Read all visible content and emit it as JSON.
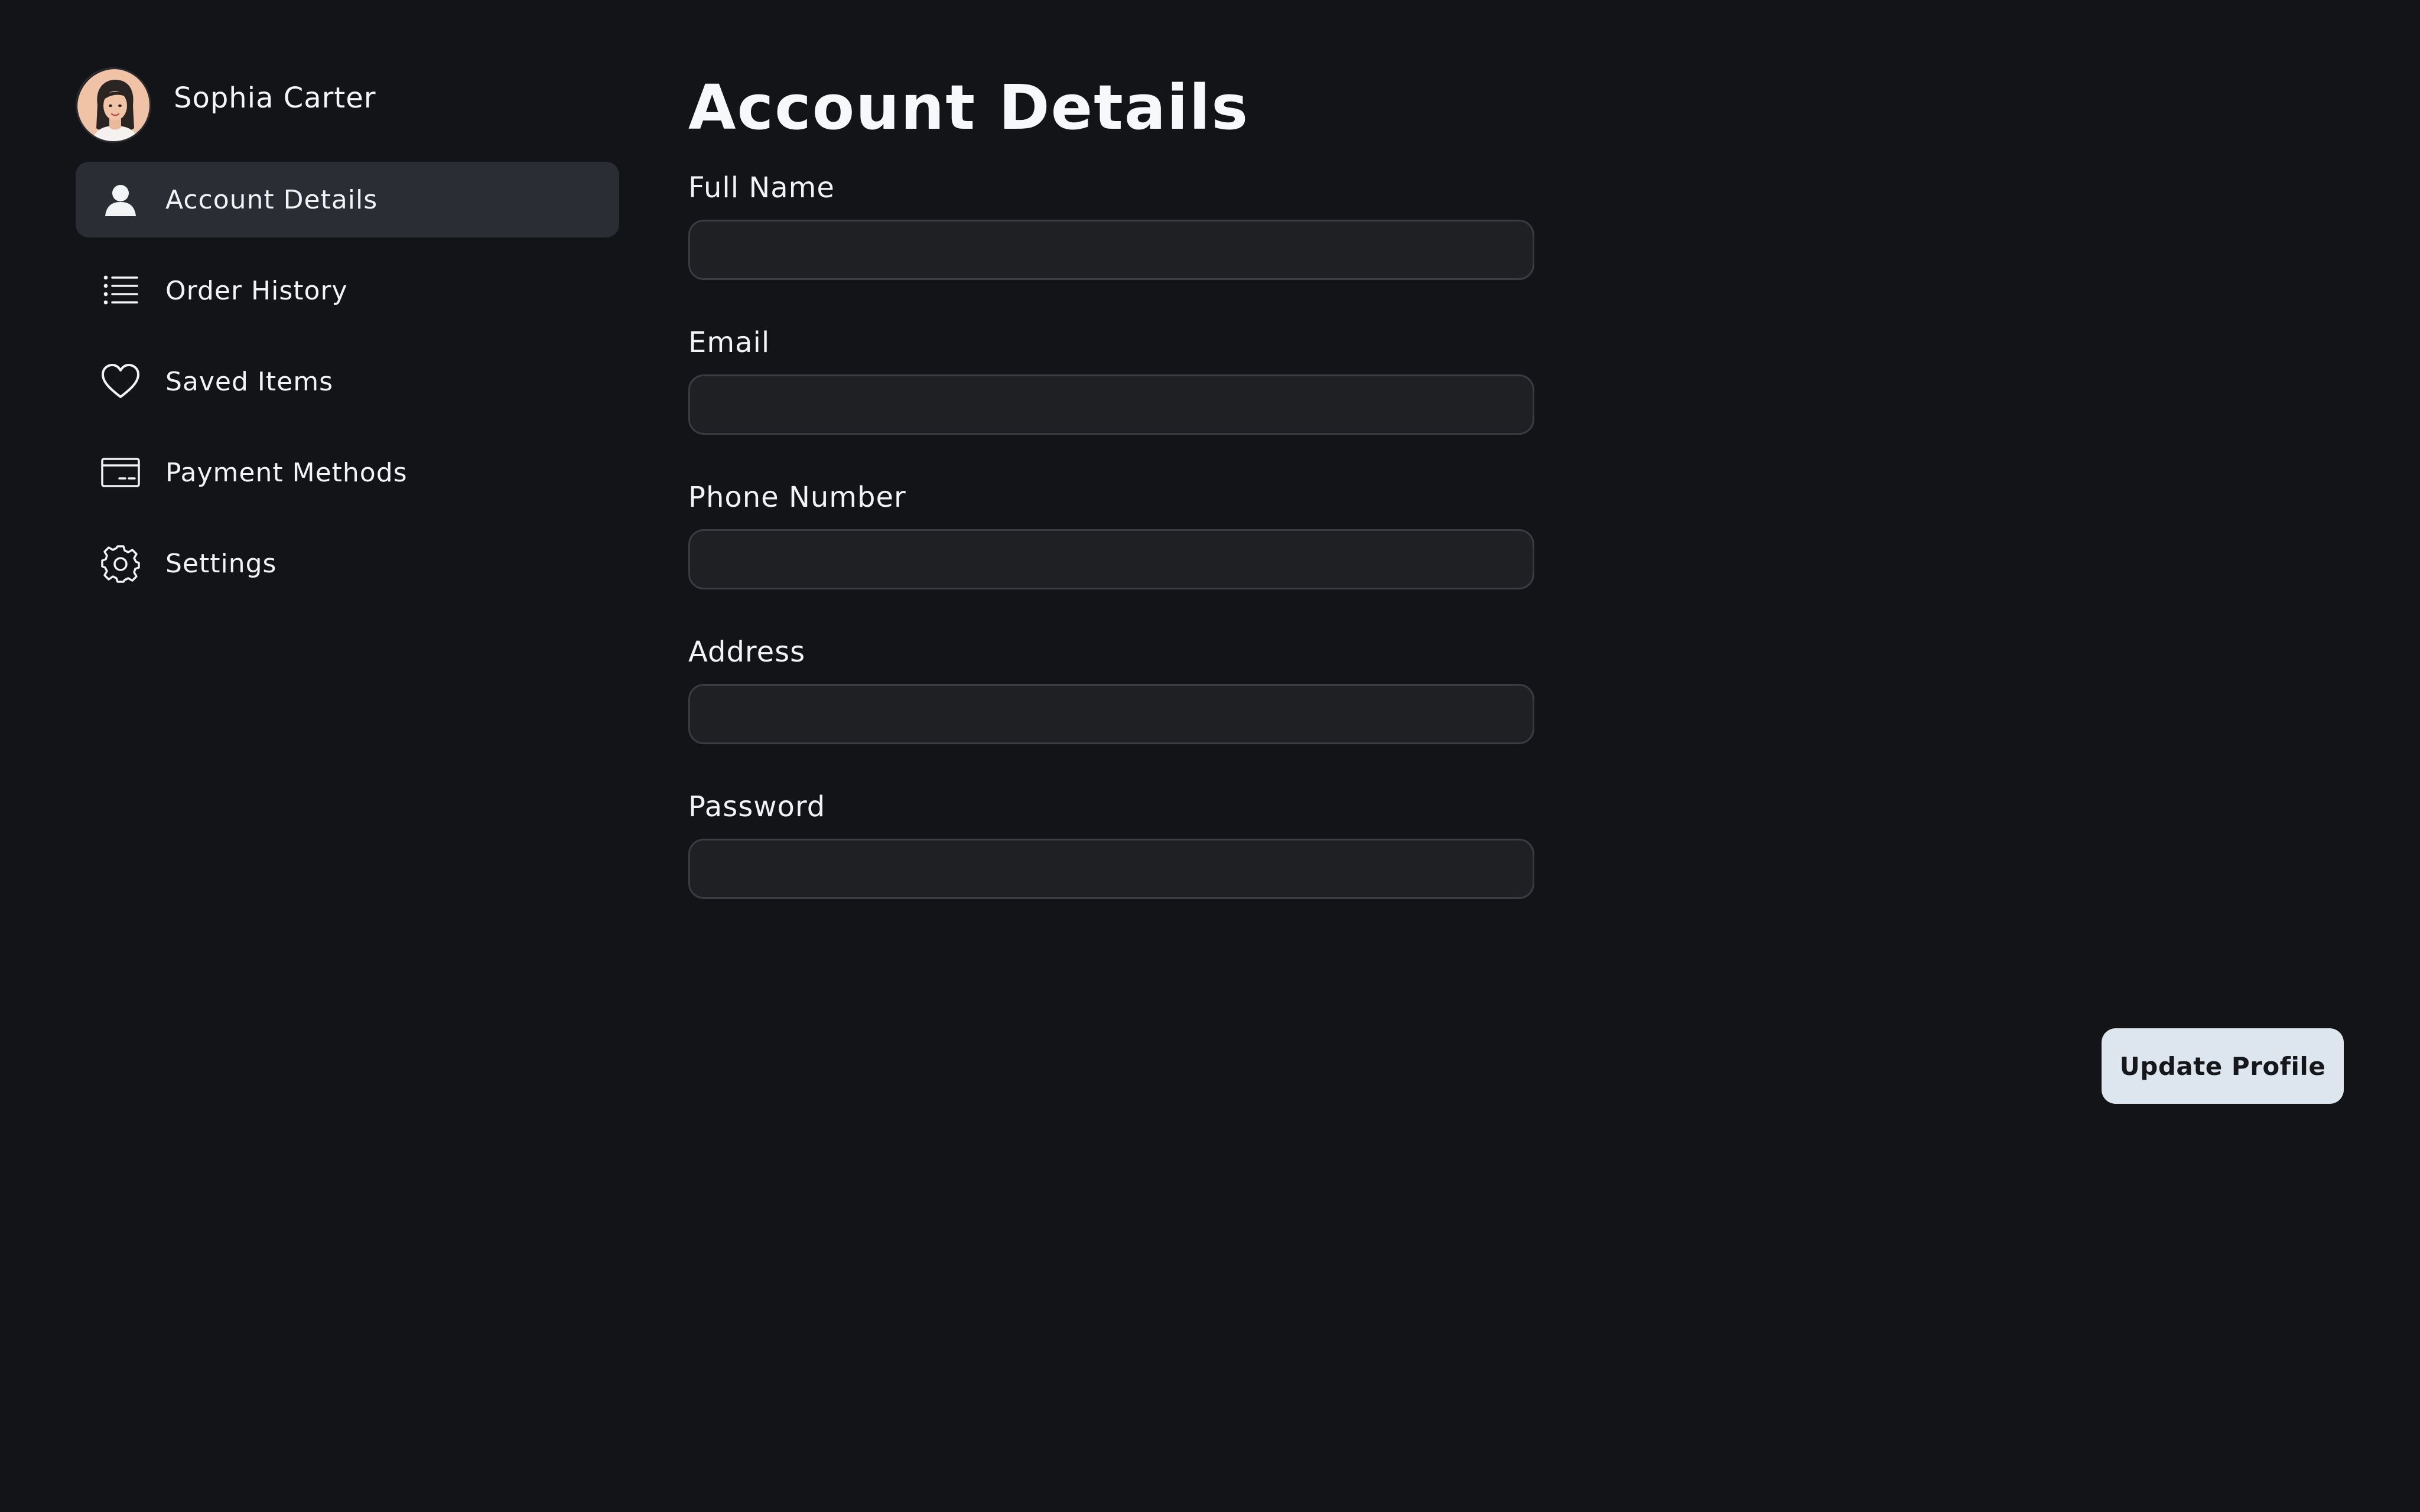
{
  "user": {
    "name": "Sophia Carter",
    "avatar_icon": "user-avatar-portrait"
  },
  "sidebar": {
    "items": [
      {
        "label": "Account Details",
        "icon": "user-icon",
        "active": true
      },
      {
        "label": "Order History",
        "icon": "list-icon",
        "active": false
      },
      {
        "label": "Saved Items",
        "icon": "heart-icon",
        "active": false
      },
      {
        "label": "Payment Methods",
        "icon": "credit-card-icon",
        "active": false
      },
      {
        "label": "Settings",
        "icon": "gear-icon",
        "active": false
      }
    ]
  },
  "main": {
    "title": "Account Details",
    "fields": [
      {
        "label": "Full Name",
        "value": "",
        "placeholder": ""
      },
      {
        "label": "Email",
        "value": "",
        "placeholder": ""
      },
      {
        "label": "Phone Number",
        "value": "",
        "placeholder": ""
      },
      {
        "label": "Address",
        "value": "",
        "placeholder": ""
      },
      {
        "label": "Password",
        "value": "",
        "placeholder": ""
      }
    ],
    "submit_label": "Update Profile"
  },
  "colors": {
    "background": "#131418",
    "active_nav": "#2a2d34",
    "input_bg": "#1f2024",
    "input_border": "#3a3c42",
    "button_bg": "#dde6ee",
    "text": "#f2f3f5"
  }
}
